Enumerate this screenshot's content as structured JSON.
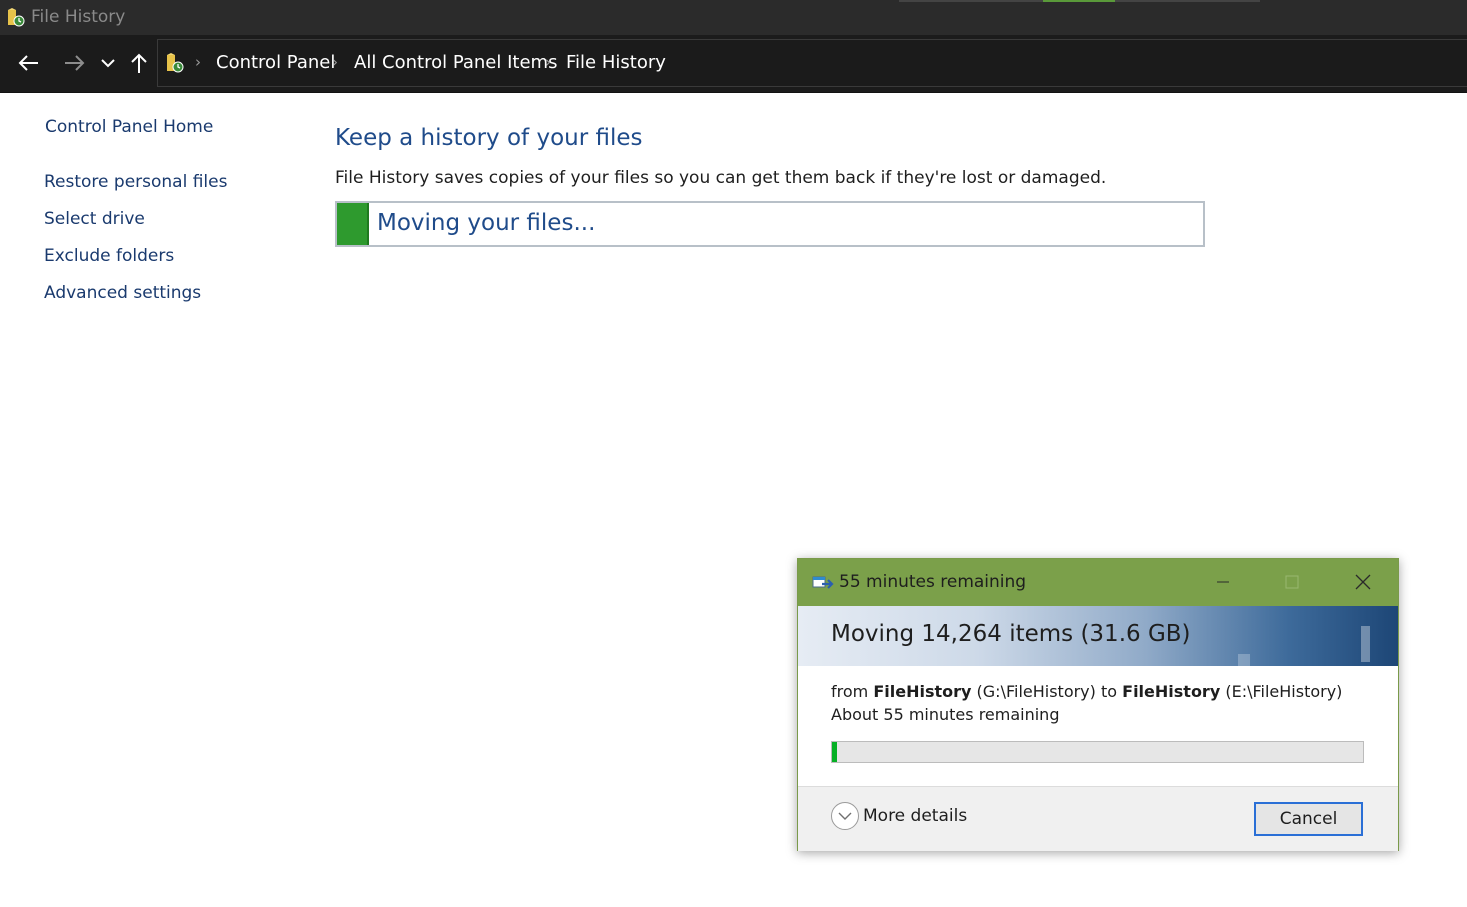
{
  "window": {
    "title": "File History",
    "icon": "file-history-icon"
  },
  "addressbar": {
    "back_icon": "arrow-left-icon",
    "forward_icon": "arrow-right-icon",
    "recent_icon": "chevron-down-icon",
    "up_icon": "arrow-up-icon",
    "breadcrumbs": [
      "Control Panel",
      "All Control Panel Items",
      "File History"
    ]
  },
  "sidebar": {
    "home": "Control Panel Home",
    "items": [
      "Restore personal files",
      "Select drive",
      "Exclude folders",
      "Advanced settings"
    ]
  },
  "main": {
    "title": "Keep a history of your files",
    "description": "File History saves copies of your files so you can get them back if they're lost or damaged.",
    "status": "Moving your files..."
  },
  "dialog": {
    "title": "55 minutes remaining",
    "banner": "Moving 14,264 items (31.6 GB)",
    "from_prefix": "from",
    "source_name": "FileHistory",
    "source_path": "(G:\\FileHistory)",
    "to_word": "to",
    "dest_name": "FileHistory",
    "dest_path": "(E:\\FileHistory)",
    "remaining": "About 55 minutes remaining",
    "progress_percent": 1,
    "more_details": "More details",
    "cancel": "Cancel"
  },
  "colors": {
    "dialog_titlebar": "#7ba04a",
    "progress_fill": "#06b025",
    "link_blue": "#1a3a6e",
    "heading_blue": "#1f4b8a"
  }
}
